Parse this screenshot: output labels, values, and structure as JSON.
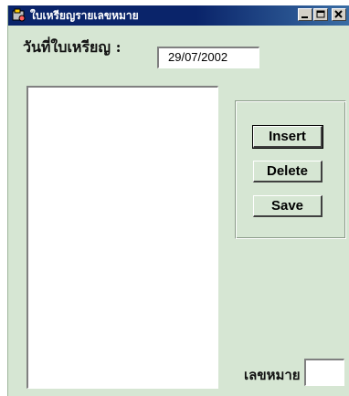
{
  "window": {
    "title": "ใบเหรียญรายเลขหมาย",
    "app_icon": "app-icon",
    "controls": [
      "minimize-icon",
      "maximize-icon",
      "close-icon"
    ]
  },
  "form": {
    "date_label": "วันที่ใบเหรียญ :",
    "date_value": "29/07/2002",
    "list_items": [],
    "buttons": {
      "insert": "Insert",
      "delete": "Delete",
      "save": "Save"
    },
    "number_label": "เลขหมาย",
    "number_value": ""
  },
  "colors": {
    "window_bg": "#d6e6d3",
    "titlebar": "#0a246a"
  }
}
